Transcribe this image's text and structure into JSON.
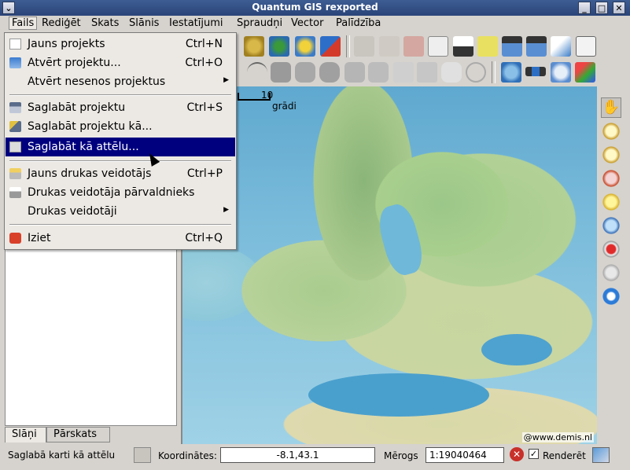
{
  "window": {
    "title": "Quantum GIS rexported"
  },
  "menubar": {
    "items": [
      {
        "label": "Fails"
      },
      {
        "label": "Rediģēt"
      },
      {
        "label": "Skats"
      },
      {
        "label": "Slānis"
      },
      {
        "label": "Iestatījumi"
      },
      {
        "label": "Spraudņi"
      },
      {
        "label": "Vector"
      },
      {
        "label": "Palīdzība"
      }
    ]
  },
  "file_menu": {
    "items": [
      {
        "label": "Jauns projekts",
        "shortcut": "Ctrl+N"
      },
      {
        "label": "Atvērt projektu...",
        "shortcut": "Ctrl+O"
      },
      {
        "label": "Atvērt nesenos projektus",
        "shortcut": ""
      },
      {
        "label": "Saglabāt projektu",
        "shortcut": "Ctrl+S"
      },
      {
        "label": "Saglabāt projektu kā...",
        "shortcut": ""
      },
      {
        "label": "Saglabāt kā attēlu...",
        "shortcut": ""
      },
      {
        "label": "Jauns drukas veidotājs",
        "shortcut": "Ctrl+P"
      },
      {
        "label": "Drukas veidotāja pārvaldnieks",
        "shortcut": ""
      },
      {
        "label": "Drukas veidotāji",
        "shortcut": ""
      },
      {
        "label": "Iziet",
        "shortcut": "Ctrl+Q"
      }
    ]
  },
  "map": {
    "scale_value": "10",
    "scale_unit": "grādi",
    "credit": "@www.demis.nl"
  },
  "left_tabs": [
    {
      "label": "Slāņi"
    },
    {
      "label": "Pārskats"
    }
  ],
  "statusbar": {
    "message": "Saglabā karti kā attēlu",
    "coords_label": "Koordinātes:",
    "coords_value": "-8.1,43.1",
    "scale_label": "Mērogs",
    "scale_value": "1:19040464",
    "render_label": "Renderēt"
  },
  "colors": {
    "highlight": "#00007f",
    "titlebar": "#2f4b82"
  }
}
